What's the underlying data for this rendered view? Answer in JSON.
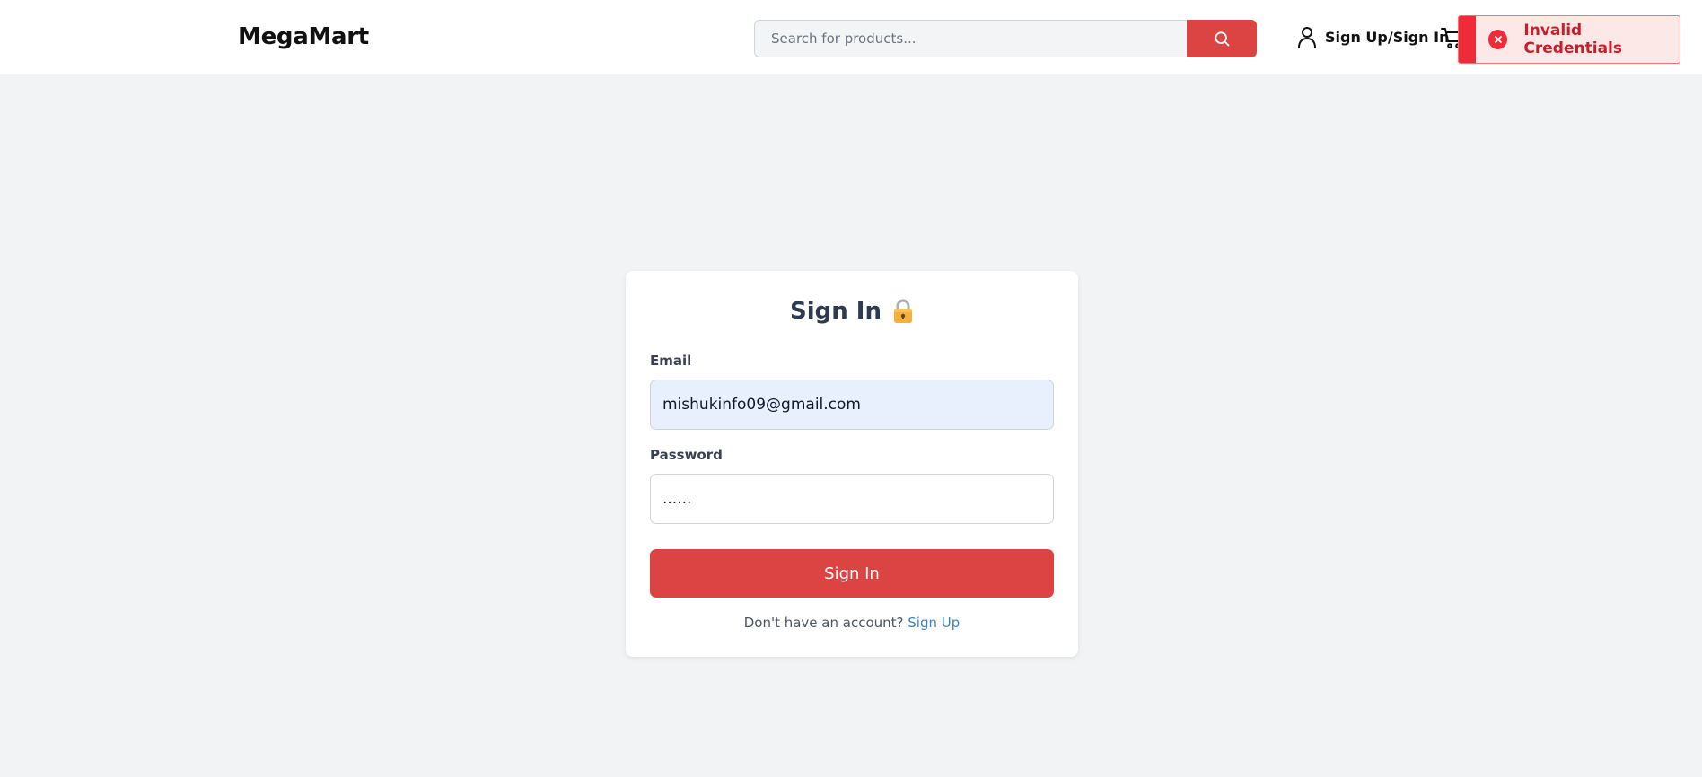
{
  "header": {
    "logo": "MegaMart",
    "search_placeholder": "Search for products...",
    "account_label": "Sign Up/Sign In"
  },
  "toast": {
    "message": "Invalid Credentials",
    "type": "error"
  },
  "form": {
    "title": "Sign In",
    "title_icon": "lock-icon",
    "email_label": "Email",
    "email_value": "mishukinfo09@gmail.com",
    "password_label": "Password",
    "password_value": "......",
    "submit_label": "Sign In",
    "footer_text": "Don't have an account?",
    "footer_link": "Sign Up"
  },
  "colors": {
    "accent": "#dc4343",
    "error": "#ef2b3a",
    "link": "#3b82c4",
    "background": "#f2f3f5"
  }
}
